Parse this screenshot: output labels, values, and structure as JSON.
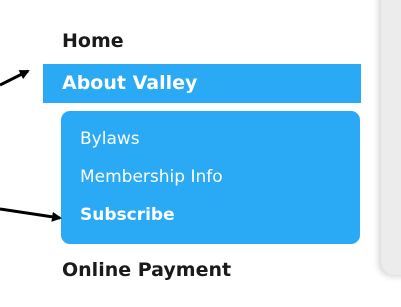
{
  "nav": {
    "home": "Home",
    "about_valley": "About Valley",
    "submenu": {
      "bylaws": "Bylaws",
      "membership_info": "Membership Info",
      "subscribe": "Subscribe"
    },
    "online_payment": "Online Payment"
  },
  "colors": {
    "active_bg": "#2aaaf5",
    "active_text": "#ffffff",
    "nav_text": "#1a1a1a",
    "arrow": "#000000"
  },
  "annotations": {
    "arrow_1_target": "about-valley",
    "arrow_2_target": "subscribe"
  }
}
